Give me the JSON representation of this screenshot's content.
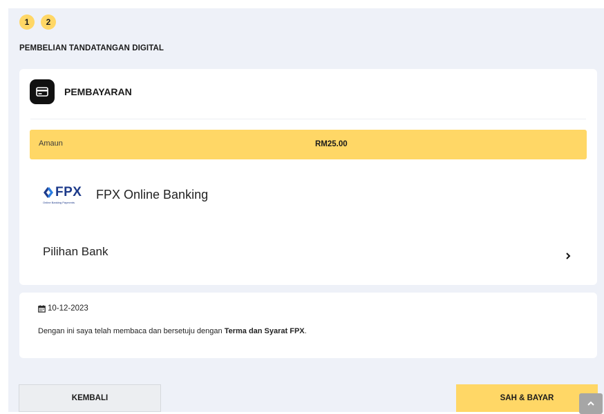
{
  "stepper": {
    "steps": [
      "1",
      "2"
    ]
  },
  "page": {
    "title": "PEMBELIAN TANDATANGAN DIGITAL"
  },
  "payment": {
    "title": "PEMBAYARAN",
    "amount_label": "Amaun",
    "amount_value": "RM25.00",
    "method_name": "FPX Online Banking",
    "fpx_logo_text": "FPX",
    "fpx_logo_subtext": "Online Banking Payments",
    "bank_choice_label": "Pilihan Bank"
  },
  "agreement": {
    "date": "10-12-2023",
    "text_prefix": "Dengan ini saya telah membaca dan bersetuju dengan ",
    "terms_link": "Terma dan Syarat FPX",
    "text_suffix": "."
  },
  "actions": {
    "back_label": "KEMBALI",
    "pay_label": "SAH & BAYAR"
  },
  "icons": {
    "payment": "credit-card-icon",
    "bank_chevron": "chevron-right-icon",
    "date": "calendar-icon",
    "scroll_top": "chevron-up-icon"
  },
  "colors": {
    "accent": "#ffd766",
    "background": "#eef1f8",
    "fpx_blue": "#1d3a8a"
  }
}
